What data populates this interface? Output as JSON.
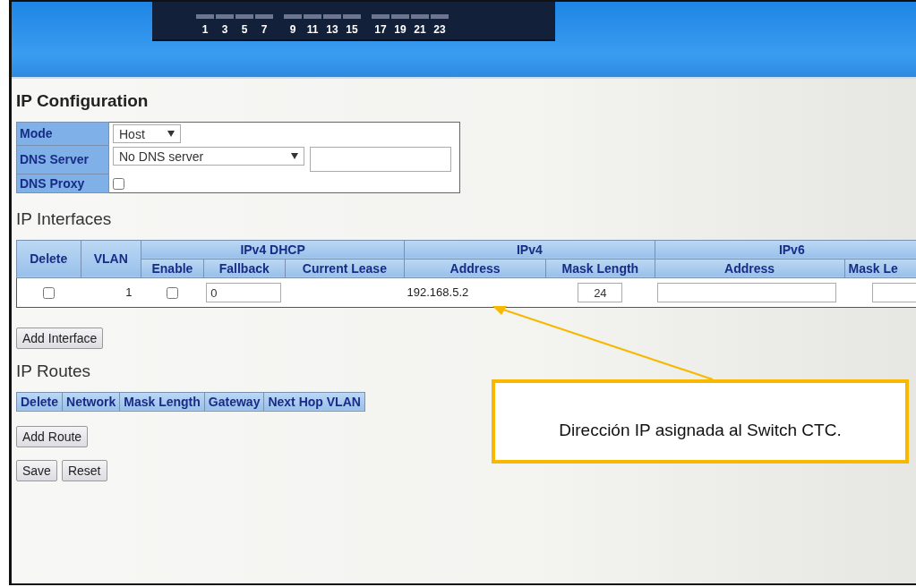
{
  "header": {
    "port_groups": [
      [
        "1",
        "3",
        "5",
        "7"
      ],
      [
        "9",
        "11",
        "13",
        "15"
      ],
      [
        "17",
        "19",
        "21",
        "23"
      ]
    ]
  },
  "ip_configuration": {
    "title": "IP Configuration",
    "mode": {
      "label": "Mode",
      "value": "Host"
    },
    "dns_server": {
      "label": "DNS Server",
      "value": "No DNS server"
    },
    "dns_proxy": {
      "label": "DNS Proxy",
      "checked": false
    }
  },
  "ip_interfaces": {
    "title": "IP Interfaces",
    "groups": [
      "IPv4 DHCP",
      "IPv4",
      "IPv6"
    ],
    "columns": [
      "Delete",
      "VLAN",
      "Enable",
      "Fallback",
      "Current Lease",
      "Address",
      "Mask Length",
      "Address",
      "Mask Le"
    ],
    "rows": [
      {
        "delete": false,
        "vlan": "1",
        "dhcp_enable": false,
        "fallback": "0",
        "ipv4_address": "192.168.5.2",
        "ipv4_mask_length": "24"
      }
    ],
    "add_button": "Add Interface"
  },
  "ip_routes": {
    "title": "IP Routes",
    "columns": [
      "Delete",
      "Network",
      "Mask Length",
      "Gateway",
      "Next Hop VLAN"
    ],
    "add_button": "Add Route"
  },
  "buttons": [
    "Save",
    "Reset"
  ],
  "annotation": {
    "text": "Dirección IP asignada al Switch CTC."
  }
}
